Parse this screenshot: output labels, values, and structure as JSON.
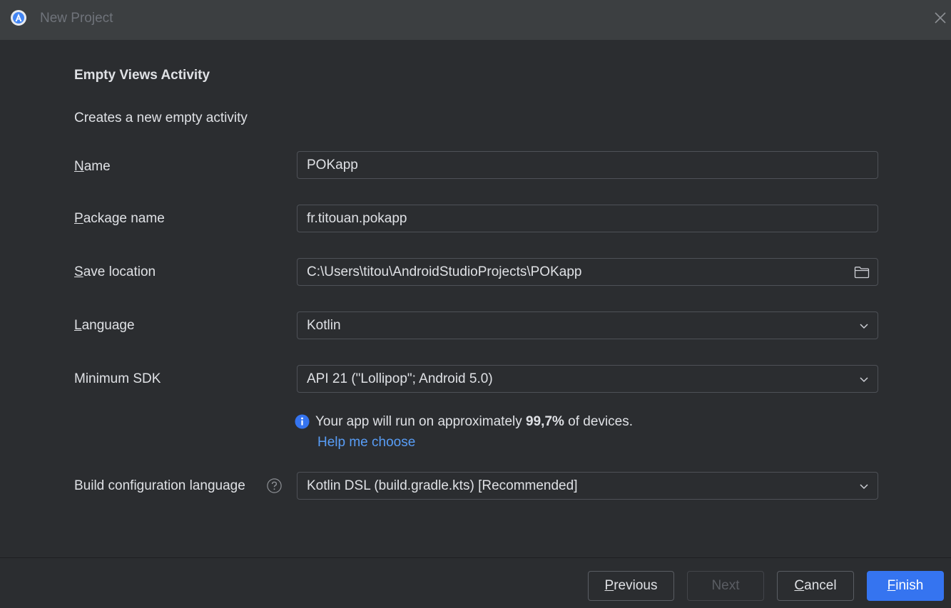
{
  "window": {
    "title": "New Project",
    "app_icon": "android-studio-icon",
    "close_icon": "close-icon"
  },
  "header": {
    "title": "Empty Views Activity",
    "description": "Creates a new empty activity"
  },
  "form": {
    "name": {
      "label_mnemonic": "N",
      "label_rest": "ame",
      "value": "POKapp"
    },
    "package_name": {
      "label_mnemonic": "P",
      "label_rest": "ackage name",
      "value": "fr.titouan.pokapp"
    },
    "save_location": {
      "label_mnemonic": "S",
      "label_rest": "ave location",
      "value": "C:\\Users\\titou\\AndroidStudioProjects\\POKapp",
      "icon": "folder-icon"
    },
    "language": {
      "label_mnemonic": "L",
      "label_rest": "anguage",
      "value": "Kotlin"
    },
    "minimum_sdk": {
      "label": "Minimum SDK",
      "value": "API 21 (\"Lollipop\"; Android 5.0)"
    },
    "sdk_info": {
      "icon": "info-icon",
      "prefix": "Your app will run on approximately ",
      "percentage": "99,7%",
      "suffix": " of devices.",
      "help_link": "Help me choose"
    },
    "build_config_language": {
      "label": "Build configuration language",
      "help_icon": "help-question-icon",
      "value": "Kotlin DSL (build.gradle.kts) [Recommended]"
    }
  },
  "footer": {
    "previous": {
      "mnemonic": "P",
      "rest": "revious"
    },
    "next": {
      "label": "Next"
    },
    "cancel": {
      "mnemonic": "C",
      "rest": "ancel"
    },
    "finish": {
      "mnemonic": "F",
      "rest": "inish"
    }
  },
  "colors": {
    "background": "#2b2d30",
    "titlebar": "#3c3f41",
    "accent": "#3574f0",
    "link": "#589df6",
    "text": "#dfe1e5"
  }
}
